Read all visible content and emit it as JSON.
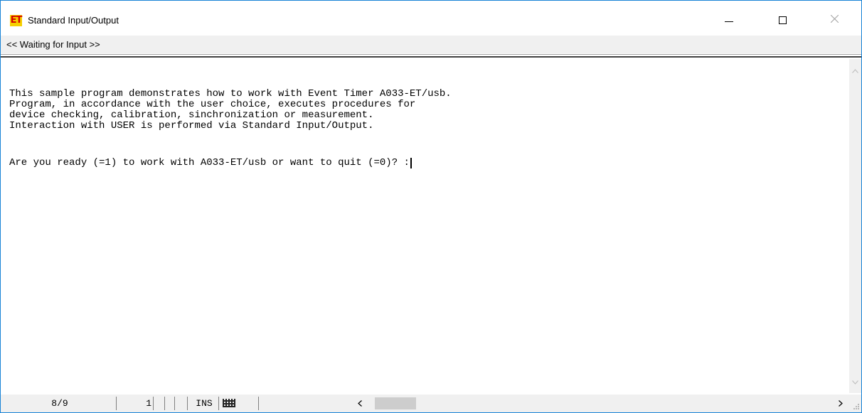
{
  "window": {
    "title": "Standard Input/Output",
    "app_icon_text": "ET"
  },
  "status": {
    "text": "<< Waiting for Input >>"
  },
  "console": {
    "lines": [
      "This sample program demonstrates how to work with Event Timer A033-ET/usb.",
      "Program, in accordance with the user choice, executes procedures for",
      "device checking, calibration, sinchronization or measurement.",
      "Interaction with USER is performed via Standard Input/Output.",
      "",
      "Are you ready (=1) to work with A033-ET/usb or want to quit (=0)? :"
    ]
  },
  "statusbar": {
    "position": "8/9",
    "column": "1",
    "mode": "INS"
  },
  "icons": {
    "app": "et-app-icon",
    "minimize": "minimize-icon",
    "maximize": "maximize-icon",
    "close": "close-icon",
    "keyboard": "keyboard-icon"
  }
}
